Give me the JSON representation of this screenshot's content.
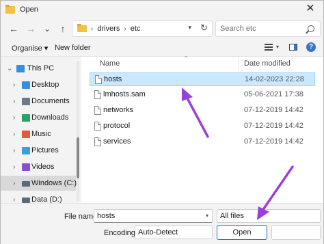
{
  "window": {
    "title": "Open",
    "close_glyph": "✕"
  },
  "nav": {
    "back_glyph": "←",
    "forward_glyph": "→",
    "recent_glyph": "⌄",
    "up_glyph": "↑",
    "breadcrumb": [
      "drivers",
      "etc"
    ],
    "breadcrumb_sep": "›",
    "search_placeholder": "Search etc"
  },
  "toolbar": {
    "organise_label": "Organise ▾",
    "new_folder_label": "New folder",
    "help_glyph": "?"
  },
  "sidebar": {
    "items": [
      {
        "label": "This PC",
        "icon": "computer-icon",
        "color": "#3a8ee0",
        "expanded": true
      },
      {
        "label": "Desktop",
        "icon": "desktop-icon",
        "color": "#3a8ee0"
      },
      {
        "label": "Documents",
        "icon": "documents-icon",
        "color": "#6b7b8c"
      },
      {
        "label": "Downloads",
        "icon": "downloads-icon",
        "color": "#2aa36b"
      },
      {
        "label": "Music",
        "icon": "music-icon",
        "color": "#e35a3c"
      },
      {
        "label": "Pictures",
        "icon": "pictures-icon",
        "color": "#3aa0d8"
      },
      {
        "label": "Videos",
        "icon": "videos-icon",
        "color": "#8a4fd0"
      },
      {
        "label": "Windows (C:)",
        "icon": "drive-icon",
        "color": "#5a6a7a",
        "selected": true
      },
      {
        "label": "Data (D:)",
        "icon": "drive-icon",
        "color": "#5a6a7a"
      }
    ]
  },
  "filelist": {
    "columns": {
      "name": "Name",
      "date": "Date modified"
    },
    "rows": [
      {
        "name": "hosts",
        "date": "14-02-2023 22:28",
        "selected": true
      },
      {
        "name": "lmhosts.sam",
        "date": "05-06-2021 17:38"
      },
      {
        "name": "networks",
        "date": "07-12-2019 14:42"
      },
      {
        "name": "protocol",
        "date": "07-12-2019 14:42"
      },
      {
        "name": "services",
        "date": "07-12-2019 14:42"
      }
    ]
  },
  "bottom": {
    "file_name_label": "File name:",
    "file_name_value": "hosts",
    "file_type_value": "All files",
    "encoding_label": "Encoding:",
    "encoding_value": "Auto-Detect",
    "open_label": "Open"
  },
  "colors": {
    "accent": "#1e6cc4",
    "selection": "#cce8ff",
    "annotation_arrow": "#9b3fd9"
  }
}
